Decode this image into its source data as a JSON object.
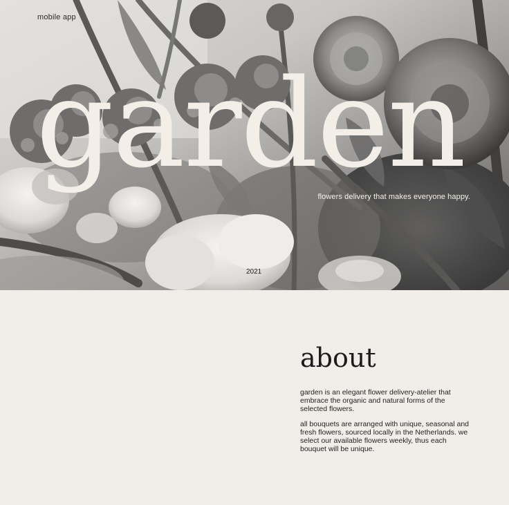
{
  "hero": {
    "brand_tag": "mobile app",
    "title": "garden",
    "tagline": "flowers delivery that makes everyone happy.",
    "year": "2021"
  },
  "about": {
    "heading": "about",
    "paragraphs": [
      "garden is an elegant flower delivery-atelier that embrace the organic and natural forms of the selected flowers.",
      "all bouquets are arranged with unique, seasonal and fresh flowers, sourced locally in the Netherlands. we select our available flowers weekly, thus each bouquet will be unique."
    ]
  },
  "colors": {
    "background": "#f1eeea",
    "title_on_photo": "#f3efe8",
    "text_dark": "#1c1c1c"
  }
}
